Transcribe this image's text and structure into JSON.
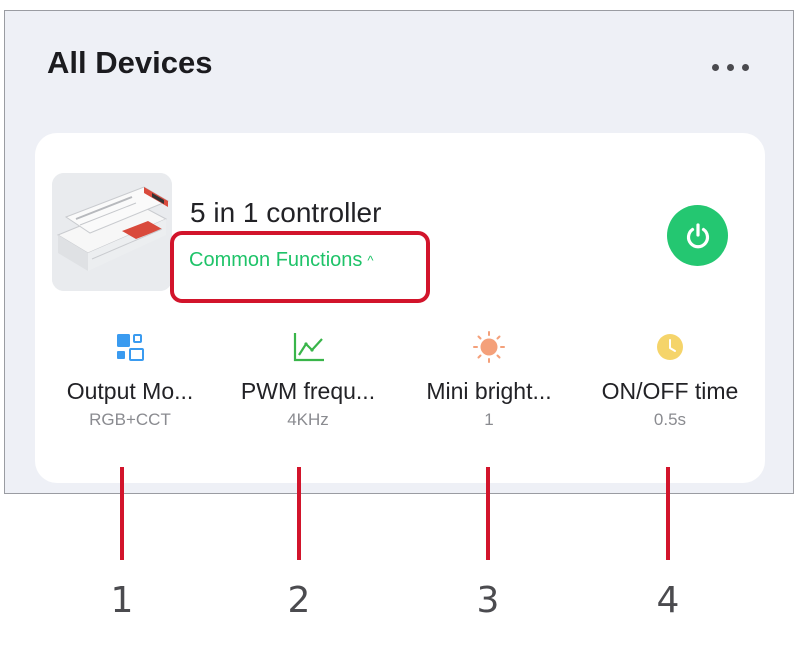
{
  "header": {
    "title": "All Devices"
  },
  "device": {
    "name": "5 in 1 controller",
    "common_functions_label": "Common Functions",
    "caret": "^"
  },
  "functions": [
    {
      "label": "Output Mo...",
      "value": "RGB+CCT",
      "icon": "output-mode-icon"
    },
    {
      "label": "PWM frequ...",
      "value": "4KHz",
      "icon": "line-chart-icon"
    },
    {
      "label": "Mini bright...",
      "value": "1",
      "icon": "sun-icon"
    },
    {
      "label": "ON/OFF time",
      "value": "0.5s",
      "icon": "timer-icon"
    }
  ],
  "callouts": [
    "1",
    "2",
    "3",
    "4"
  ],
  "colors": {
    "accent_green": "#24c771",
    "annotation_red": "#d2142b",
    "output_mode_blue": "#3a9bf0",
    "chart_green": "#39b54a",
    "sun_orange": "#f4a07a",
    "timer_yellow": "#f5d46a"
  }
}
